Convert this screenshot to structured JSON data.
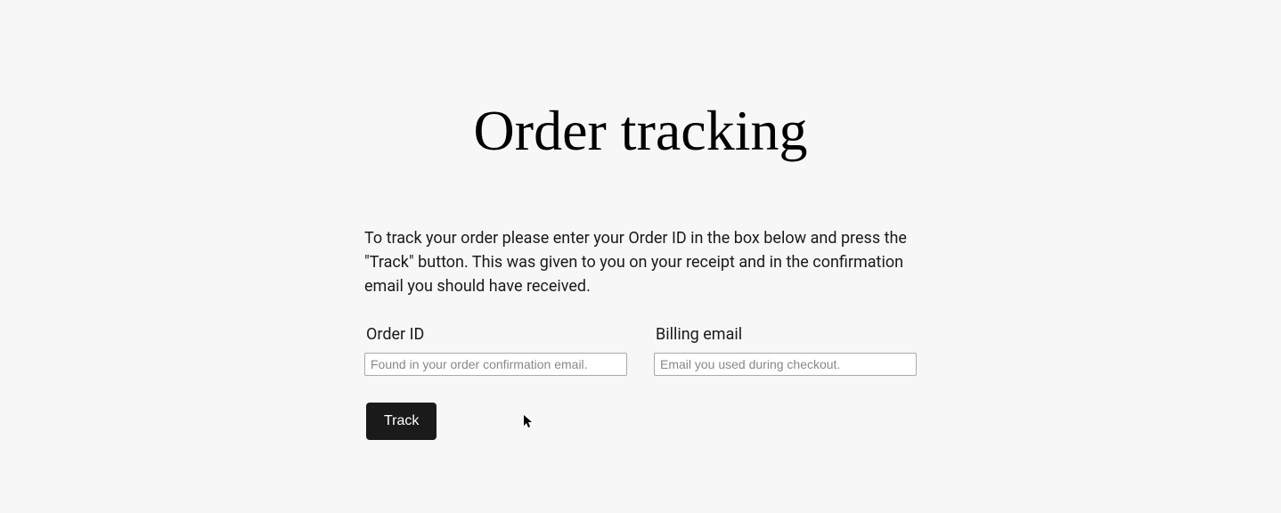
{
  "title": "Order tracking",
  "description": "To track your order please enter your Order ID in the box below and press the \"Track\" button. This was given to you on your receipt and in the confirmation email you should have received.",
  "form": {
    "order_id": {
      "label": "Order ID",
      "placeholder": "Found in your order confirmation email.",
      "value": ""
    },
    "billing_email": {
      "label": "Billing email",
      "placeholder": "Email you used during checkout.",
      "value": ""
    },
    "submit_label": "Track"
  }
}
